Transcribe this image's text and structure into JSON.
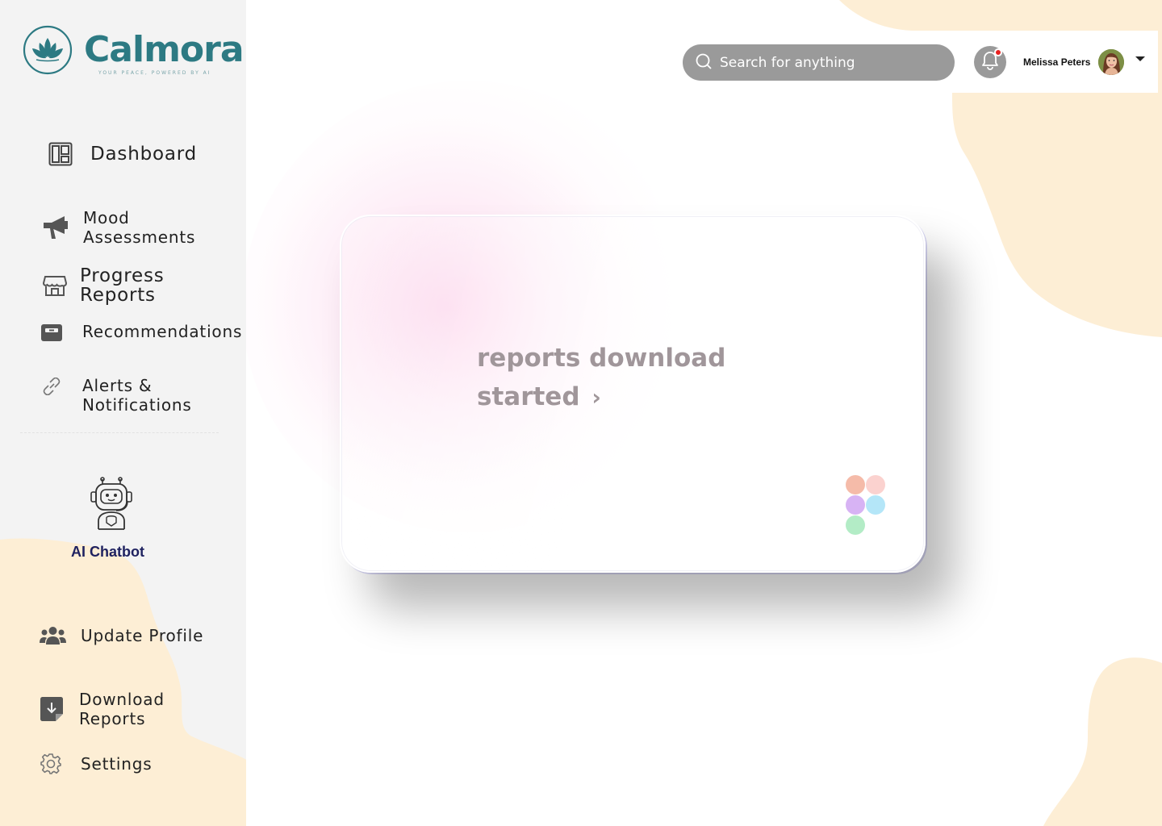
{
  "brand": {
    "name": "Calmora",
    "tagline": "YOUR PEACE, POWERED BY AI",
    "color": "#2d7a83"
  },
  "sidebar": {
    "items": [
      {
        "label": "Dashboard",
        "icon": "dashboard-icon"
      },
      {
        "label": "Mood Assessments",
        "icon": "megaphone-icon"
      },
      {
        "label": "Progress Reports",
        "icon": "storefront-icon"
      },
      {
        "label": "Recommendations",
        "icon": "inbox-icon"
      },
      {
        "label": "Alerts &",
        "label2": "Notifications",
        "icon": "link-icon"
      }
    ],
    "chatbot": {
      "label": "AI Chatbot",
      "icon": "robot-icon"
    },
    "bottom_items": [
      {
        "label": "Update Profile",
        "icon": "users-icon"
      },
      {
        "label": "Download",
        "label2": "Reports",
        "icon": "download-icon"
      },
      {
        "label": "Settings",
        "icon": "gear-icon"
      }
    ]
  },
  "header": {
    "search_placeholder": "Search for anything",
    "notification_icon": "bell-icon",
    "user_name": "Melissa Peters"
  },
  "card": {
    "message_line1": "reports download",
    "message_line2": "started",
    "chevron": "›"
  },
  "colors": {
    "sidebar_bg": "#f3f3f3",
    "peach": "#fdeed5",
    "search_bg": "#9a9a9a",
    "notification_dot": "#e8211f",
    "chatbot_text": "#1f2260",
    "card_text": "#a0969a"
  }
}
